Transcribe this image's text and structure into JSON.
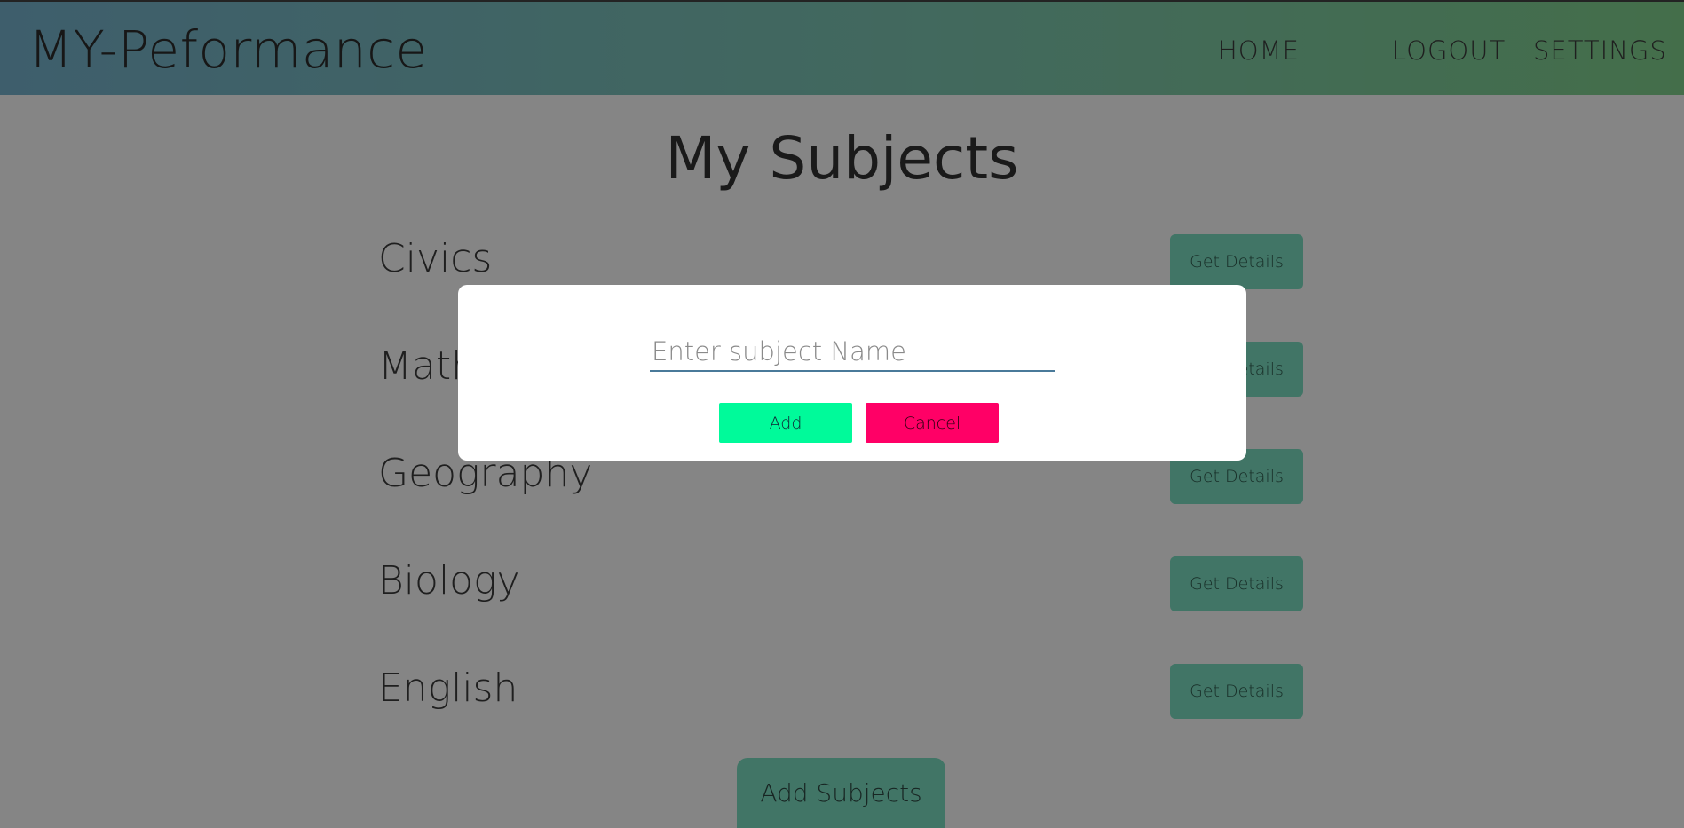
{
  "header": {
    "brand": "MY-Peformance",
    "nav": {
      "home": "HOME",
      "logout": "LOGOUT",
      "settings": "SETTINGS"
    }
  },
  "main": {
    "title": "My Subjects",
    "subjects": [
      {
        "name": "Civics",
        "button": "Get Details"
      },
      {
        "name": "Mathematics",
        "button": "Get Details"
      },
      {
        "name": "Geography",
        "button": "Get Details"
      },
      {
        "name": "Biology",
        "button": "Get Details"
      },
      {
        "name": "English",
        "button": "Get Details"
      }
    ],
    "add_subjects_label": "Add Subjects"
  },
  "modal": {
    "input_placeholder": "Enter subject Name",
    "input_value": "",
    "add_label": "Add",
    "cancel_label": "Cancel"
  },
  "colors": {
    "add_button": "#00fa9a",
    "cancel_button": "#ff0066",
    "details_button": "#7ee0c4"
  }
}
